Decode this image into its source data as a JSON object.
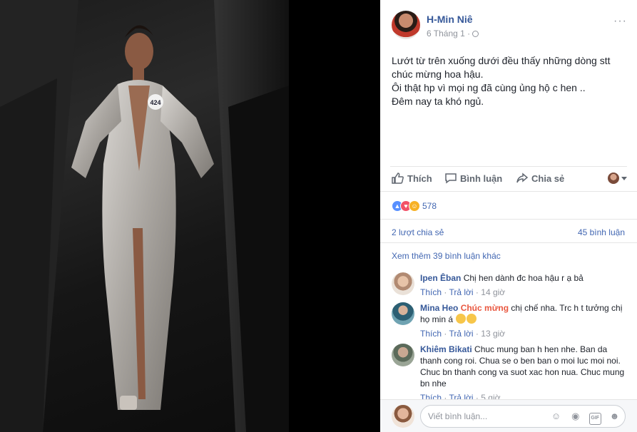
{
  "post": {
    "author": "H-Min Niê",
    "date": "6 Tháng 1 ·",
    "more_label": "···",
    "text_lines": [
      "Lướt từ trên xuống dưới đều thấy những dòng stt",
      "chúc mừng hoa hậu.",
      "Ôi thật hp vì mọi ng đã cùng ủng hộ c hen ..",
      "Đêm nay ta khó ngủ."
    ],
    "photo": {
      "bib_number": "424"
    }
  },
  "actions": {
    "like": "Thích",
    "comment": "Bình luận",
    "share": "Chia sẻ"
  },
  "stats": {
    "reaction_count": "578",
    "shares": "2 lượt chia sẻ",
    "comments": "45 bình luận",
    "view_more": "Xem thêm 39 bình luận khác"
  },
  "comments": [
    {
      "name": "Ipen Êban",
      "tag": "",
      "text": "Chị hen dành đc hoa hậu r ạ bả",
      "like": "Thích",
      "reply": "Trả lời",
      "time": "14 giờ"
    },
    {
      "name": "Mina Heo",
      "tag": "Chúc mừng",
      "text": "chị chế nha. Trc h t tưởng chị họ min á",
      "like": "Thích",
      "reply": "Trả lời",
      "time": "13 giờ"
    },
    {
      "name": "Khiêm Bikati",
      "tag": "",
      "text": "Chuc mung ban h hen nhe. Ban da thanh cong roi. Chua se o ben ban o moi luc moi noi. Chuc bn thanh cong va suot xac hon nua. Chuc mung bn nhe",
      "like": "Thích",
      "reply": "Trả lời",
      "time": "5 giờ"
    }
  ],
  "composer": {
    "placeholder": "Viết bình luận...",
    "gif_label": "GIF"
  },
  "colors": {
    "link": "#365899",
    "accent": "#4267b2",
    "muted": "#90949c",
    "like_reaction": "#5890ff",
    "love_reaction": "#f25268",
    "haha_reaction": "#f7b125"
  },
  "icons": [
    "globe-icon",
    "like-icon",
    "comment-icon",
    "share-icon",
    "emoji-icon",
    "camera-icon",
    "gif-icon",
    "sticker-icon"
  ]
}
